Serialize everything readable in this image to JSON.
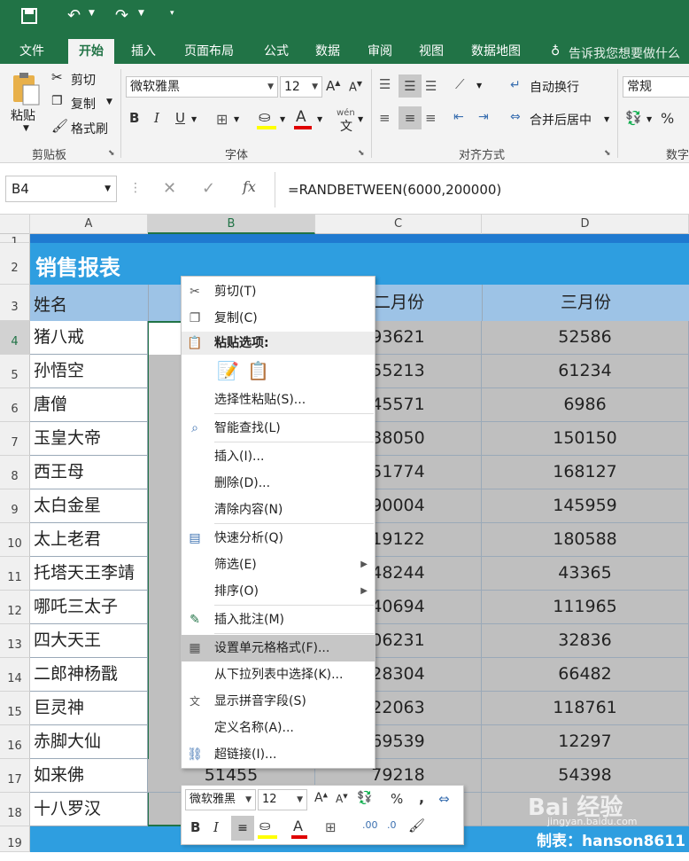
{
  "quick_access": {
    "save_icon": "save-icon",
    "undo_icon": "undo-icon",
    "redo_icon": "redo-icon",
    "customize_icon": "customize-icon"
  },
  "ribbon_tabs": [
    "文件",
    "开始",
    "插入",
    "页面布局",
    "公式",
    "数据",
    "审阅",
    "视图",
    "数据地图"
  ],
  "tell_me": "告诉我您想要做什么",
  "clipboard": {
    "paste": "粘贴",
    "cut": "剪切",
    "copy": "复制",
    "format_painter": "格式刷",
    "label": "剪贴板"
  },
  "font": {
    "name": "微软雅黑",
    "size": "12",
    "bold": "B",
    "italic": "I",
    "underline": "U",
    "font_color_letter": "A",
    "phonetic": "wén",
    "label": "字体"
  },
  "alignment": {
    "wrap_text": "自动换行",
    "merge_center": "合并后居中",
    "label": "对齐方式"
  },
  "number": {
    "format": "常规",
    "percent": "%",
    "label": "数字"
  },
  "formula_bar": {
    "name_box": "B4",
    "cancel": "✕",
    "enter": "✓",
    "fx": "fx",
    "formula": "=RANDBETWEEN(6000,200000)"
  },
  "columns": [
    "A",
    "B",
    "C",
    "D"
  ],
  "rows": [
    "1",
    "2",
    "3",
    "4",
    "5",
    "6",
    "7",
    "8",
    "9",
    "10",
    "11",
    "12",
    "13",
    "14",
    "15",
    "16",
    "17",
    "18",
    "19"
  ],
  "sheet": {
    "title": "销售报表",
    "headers": [
      "姓名",
      "",
      "二月份",
      "三月份"
    ],
    "names": [
      "猪八戒",
      "孙悟空",
      "唐僧",
      "玉皇大帝",
      "西王母",
      "太白金星",
      "太上老君",
      "托塔天王李靖",
      "哪吒三太子",
      "四大天王",
      "二郎神杨戬",
      "巨灵神",
      "赤脚大仙",
      "如来佛",
      "十八罗汉"
    ],
    "feb": [
      "93621",
      "55213",
      "45571",
      "38050",
      "51774",
      "90004",
      "19122",
      "48244",
      "40694",
      "06231",
      "28304",
      "22063",
      "69539",
      "79218",
      ""
    ],
    "mar": [
      "52586",
      "61234",
      "6986",
      "150150",
      "168127",
      "145959",
      "180588",
      "43365",
      "111965",
      "32836",
      "66482",
      "118761",
      "12297",
      "54398",
      ""
    ],
    "b17": "51455"
  },
  "context_menu": {
    "cut": "剪切(T)",
    "copy": "复制(C)",
    "paste_options": "粘贴选项:",
    "paste_special": "选择性粘贴(S)...",
    "smart_lookup": "智能查找(L)",
    "insert": "插入(I)...",
    "delete": "删除(D)...",
    "clear": "清除内容(N)",
    "quick_analysis": "快速分析(Q)",
    "filter": "筛选(E)",
    "sort": "排序(O)",
    "insert_comment": "插入批注(M)",
    "format_cells": "设置单元格格式(F)...",
    "pick_list": "从下拉列表中选择(K)...",
    "phonetic": "显示拼音字段(S)",
    "define_name": "定义名称(A)...",
    "hyperlink": "超链接(I)..."
  },
  "mini_toolbar": {
    "font": "微软雅黑",
    "size": "12",
    "percent": "%",
    "comma": ",",
    "bold": "B",
    "italic": "I",
    "font_color_letter": "A"
  },
  "watermark": {
    "site": "Bai 经验",
    "url": "jingyan.baidu.com",
    "author": "制表：hanson8611"
  },
  "colors": {
    "excel_green": "#217346",
    "header_blue": "#9dc3e6",
    "title_blue": "#2e9ee0",
    "selection_gray": "#bfbfbf"
  }
}
